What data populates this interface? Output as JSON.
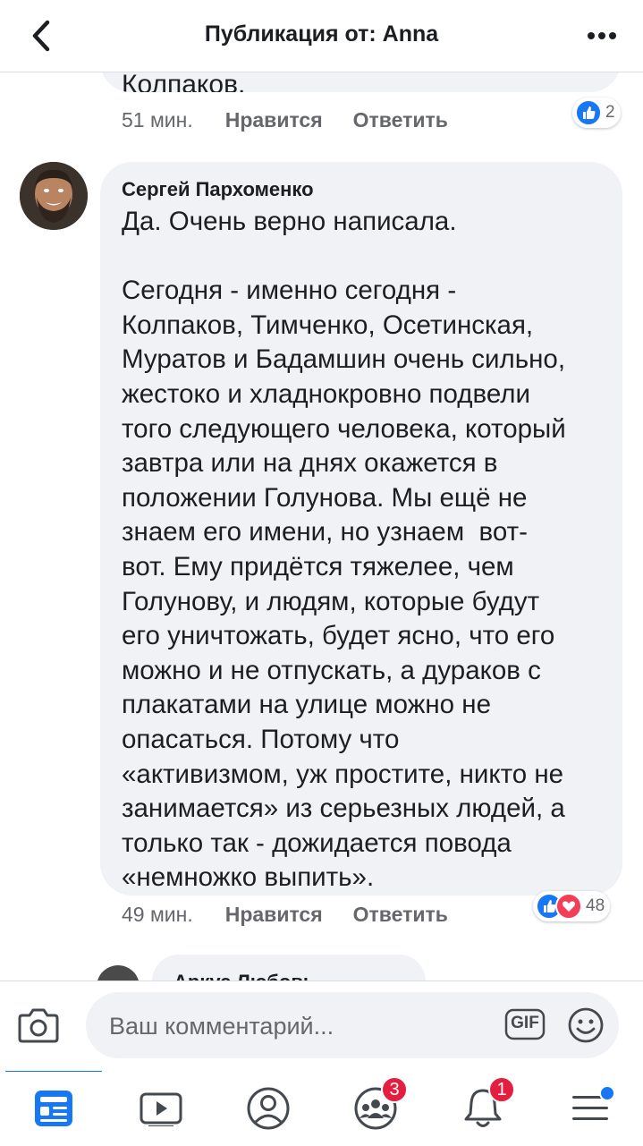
{
  "header": {
    "title": "Публикация от: Anna"
  },
  "previous_comment": {
    "text_tail": "Колпаков.",
    "time": "51 мин.",
    "like_label": "Нравится",
    "reply_label": "Ответить",
    "reaction_count": "2"
  },
  "comment": {
    "author": "Сергей Пархоменко",
    "text": "Да. Очень верно написала.\n\nСегодня - именно сегодня -\nКолпаков, Тимченко, Осетинская,\nМуратов и Бадамшин очень сильно,\nжестоко и хладнокровно подвели\nтого следующего человека, который\nзавтра или на днях окажется в\nположении Голунова. Мы ещё не\nзнаем его имени, но узнаем  вот-\nвот. Ему придётся тяжелее, чем\nГолунову, и людям, которые будут\nего уничтожать, будет ясно, что его\nможно и не отпускать, а дураков с\nплакатами на улице можно не\nопасаться. Потому что\n«активизмом, уж простите, никто не\nзанимается» из серьезных людей, а\nтолько так - дожидается повода\n«немножко выпить».",
    "time": "49 мин.",
    "like_label": "Нравится",
    "reply_label": "Ответить",
    "reaction_count": "48"
  },
  "next_comment": {
    "author_partial": "Аркус Любовь"
  },
  "composer": {
    "placeholder": "Ваш комментарий...",
    "gif_label": "GIF"
  },
  "tabbar": {
    "groups_badge": "3",
    "notifications_badge": "1"
  },
  "colors": {
    "accent": "#1877f2",
    "bubble": "#f0f2f5",
    "badge": "#e41e3f",
    "love": "#f33e58"
  }
}
